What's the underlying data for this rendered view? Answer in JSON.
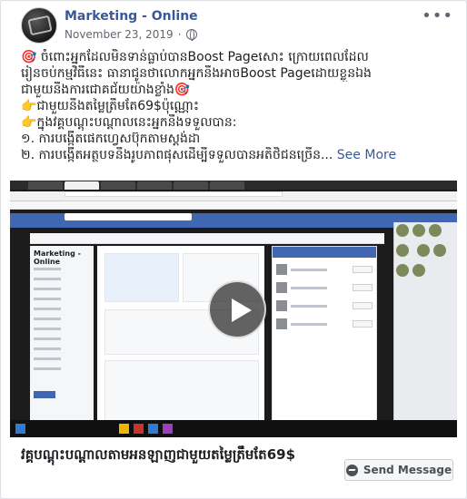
{
  "post": {
    "page_name": "Marketing - Online",
    "date": "November 23, 2019",
    "separator": "·",
    "more_label": "•••",
    "text_lines": [
      "🎯 ចំពោះអ្នកដែលមិនទាន់ធ្លាប់បានBoost Pageសោះ ក្រោយពេលដែល",
      "រៀនចប់កម្មវិធីនេះ ធានាជូនថាលោកអ្នកនឹងអាចBoost Pageដោយខ្លួនឯង",
      "ជាមួយនឹងការជោគជ័យយ៉ាងខ្លាំង🎯",
      "👉ជាមួយនឹងតម្លៃត្រឹមតែ69$ប៉ុណ្ណោះ",
      "👉ក្នុងវគ្គបណ្តុះបណ្តាលនេះអ្នកនឹងទទួលបាន:",
      "១. ការបង្កើតផេកហ្វេសប៊ុកតាមស្តង់ដា",
      "២. ការបង្កើតអត្ថបទនឹងរូបភាពផុសដើម្បីទទួលបានអតិថិជនច្រើន..."
    ],
    "see_more_label": "See More"
  },
  "video": {
    "screen_page_name": "Marketing - Online",
    "play_label": "Play"
  },
  "footer": {
    "title": "វគ្គបណ្តុះបណ្តាលតាមអនឡាញជាមួយតម្លៃត្រឹមតែ69$",
    "send_message_label": "Send Message"
  },
  "colors": {
    "link": "#385898",
    "facebook_blue": "#4267b2"
  }
}
